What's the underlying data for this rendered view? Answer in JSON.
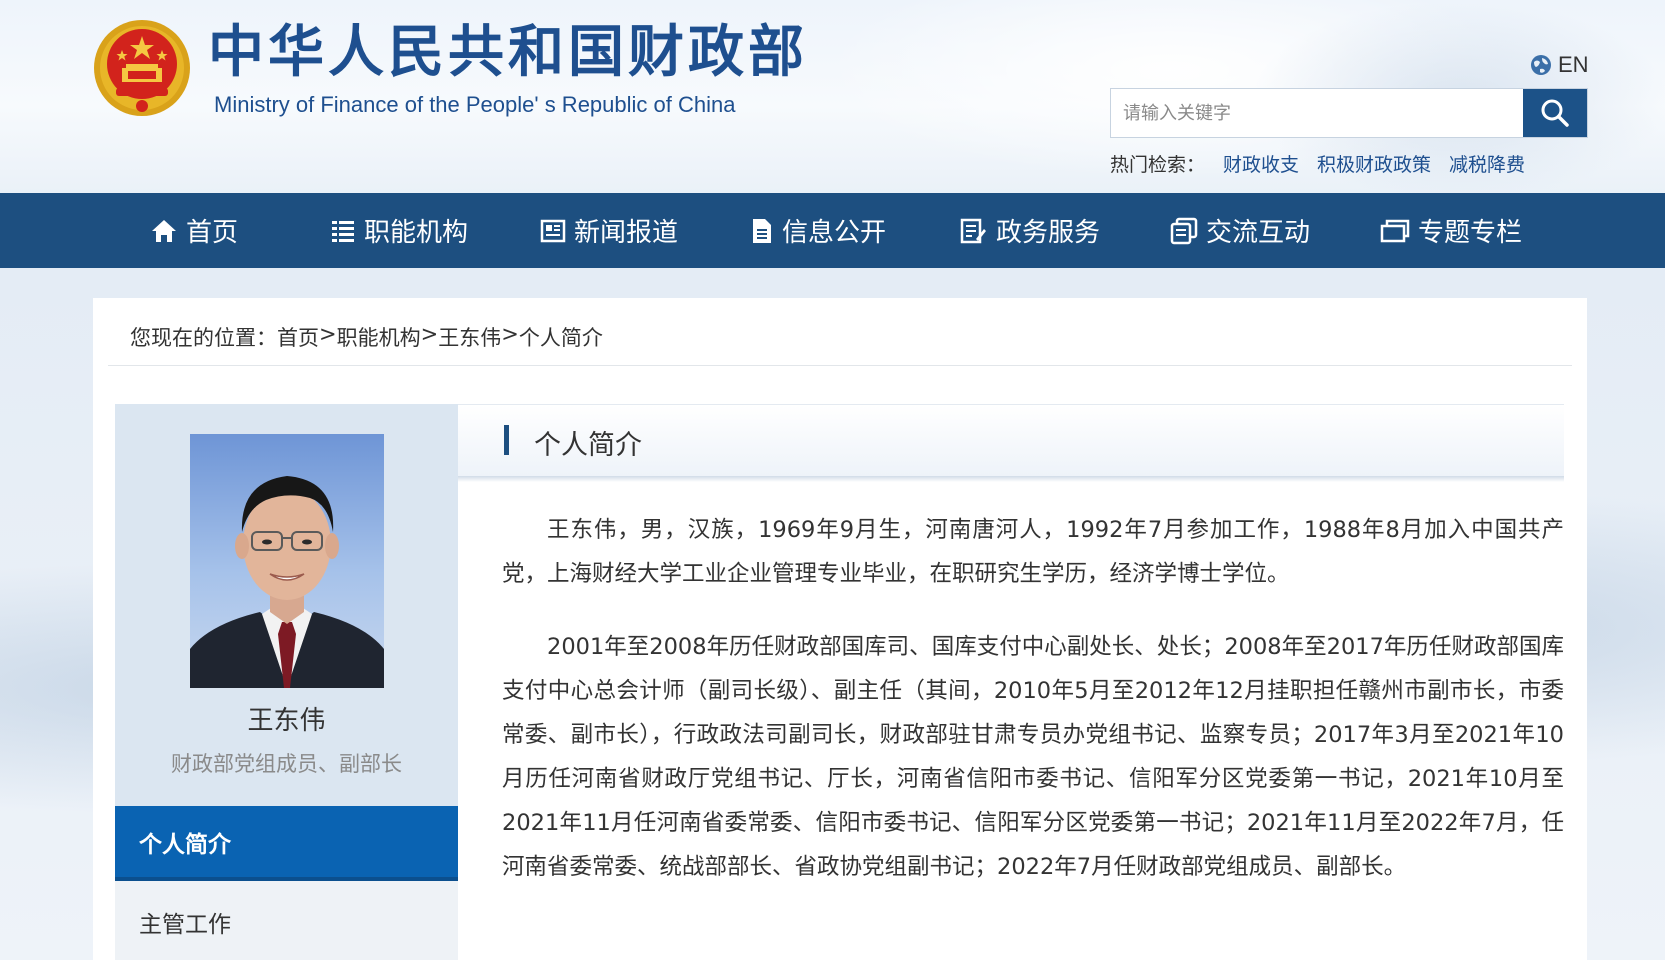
{
  "header": {
    "title_cn": "中华人民共和国财政部",
    "title_en": "Ministry of Finance of the People' s Republic of China",
    "lang_label": "EN",
    "search_placeholder": "请输入关键字",
    "hot_label": "热门检索：",
    "hot_items": [
      "财政收支",
      "积极财政政策",
      "减税降费"
    ]
  },
  "nav": {
    "items": [
      {
        "label": "首页",
        "icon": "home-icon"
      },
      {
        "label": "职能机构",
        "icon": "list-icon"
      },
      {
        "label": "新闻报道",
        "icon": "newspaper-icon"
      },
      {
        "label": "信息公开",
        "icon": "document-icon"
      },
      {
        "label": "政务服务",
        "icon": "service-icon"
      },
      {
        "label": "交流互动",
        "icon": "chat-icon"
      },
      {
        "label": "专题专栏",
        "icon": "window-icon"
      }
    ]
  },
  "breadcrumb": {
    "prefix": "您现在的位置：",
    "items": [
      "首页",
      "职能机构",
      "王东伟",
      "个人简介"
    ],
    "separator": ">"
  },
  "profile": {
    "name": "王东伟",
    "title": "财政部党组成员、副部长"
  },
  "sidebar": {
    "items": [
      "个人简介",
      "主管工作"
    ]
  },
  "section": {
    "title": "个人简介"
  },
  "bio": {
    "paragraphs": [
      "王东伟，男，汉族，1969年9月生，河南唐河人，1992年7月参加工作，1988年8月加入中国共产党，上海财经大学工业企业管理专业毕业，在职研究生学历，经济学博士学位。",
      "2001年至2008年历任财政部国库司、国库支付中心副处长、处长；2008年至2017年历任财政部国库支付中心总会计师（副司长级）、副主任（其间，2010年5月至2012年12月挂职担任赣州市副市长，市委常委、副市长），行政政法司副司长，财政部驻甘肃专员办党组书记、监察专员；2017年3月至2021年10月历任河南省财政厅党组书记、厅长，河南省信阳市委书记、信阳军分区党委第一书记，2021年10月至2021年11月任河南省委常委、信阳市委书记、信阳军分区党委第一书记；2021年11月至2022年7月，任河南省委常委、统战部部长、省政协党组副书记；2022年7月任财政部党组成员、副部长。"
    ]
  },
  "colors": {
    "brand_blue": "#1d4f80",
    "active_blue": "#0a63b2",
    "title_blue": "#1e4f8f"
  }
}
